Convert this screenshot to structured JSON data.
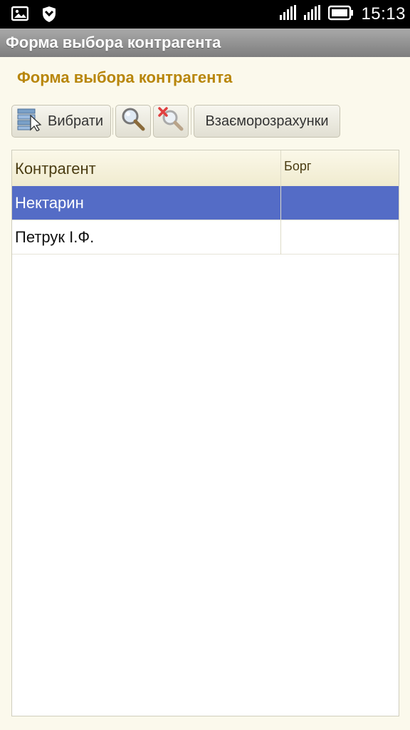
{
  "status_bar": {
    "time": "15:13",
    "icons": [
      "image-notification-icon",
      "shield-icon",
      "signal-icon",
      "signal-icon-2",
      "battery-icon"
    ]
  },
  "app_bar": {
    "title": "Форма выбора контрагента"
  },
  "form": {
    "title": "Форма выбора контрагента"
  },
  "toolbar": {
    "select_label": "Вибрати",
    "settlements_label": "Взаєморозрахунки"
  },
  "table": {
    "columns": [
      "Контрагент",
      "Борг"
    ],
    "rows": [
      {
        "name": "Нектарин",
        "debt": "",
        "selected": true
      },
      {
        "name": "Петрук І.Ф.",
        "debt": "",
        "selected": false
      }
    ]
  },
  "colors": {
    "accent_title": "#b8860b",
    "selection": "#546cc6",
    "background": "#fbf9ec"
  }
}
